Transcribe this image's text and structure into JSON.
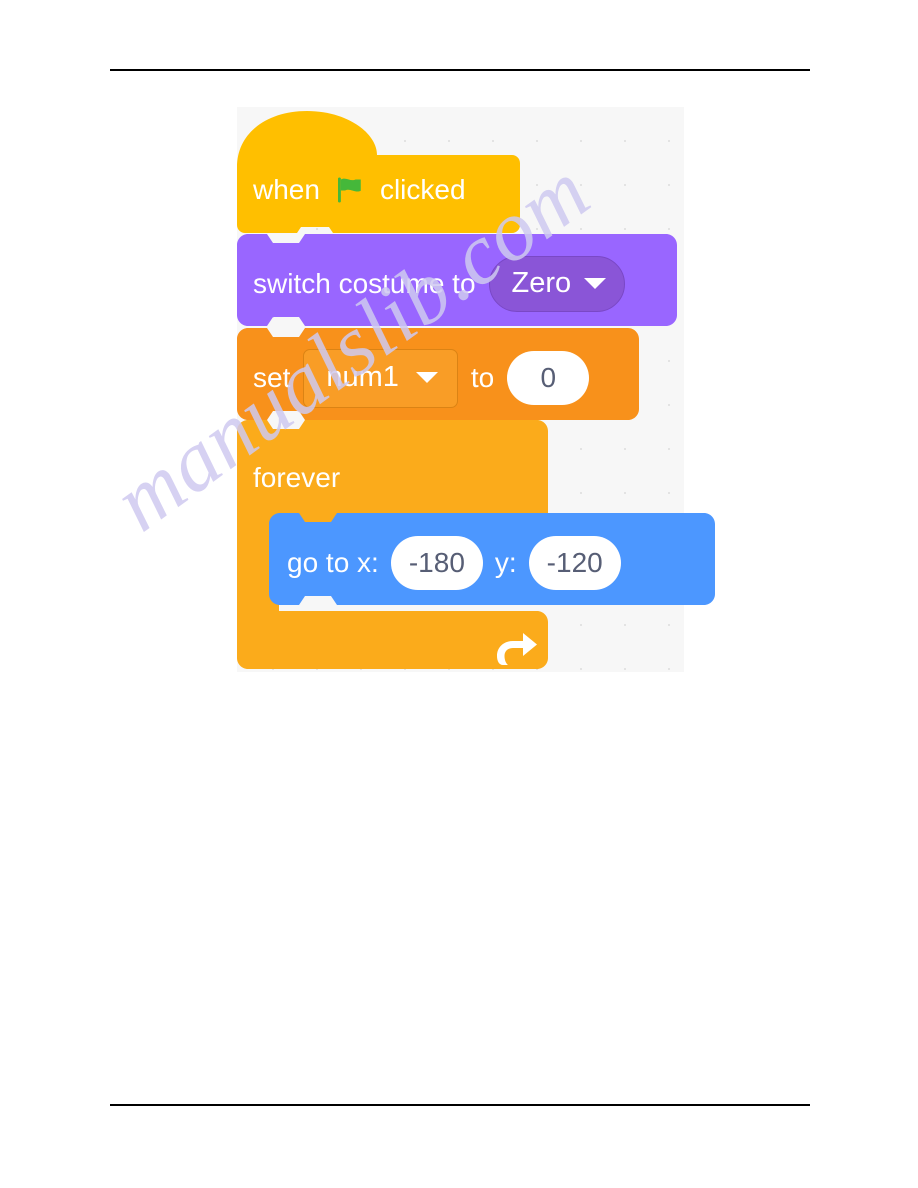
{
  "page": {
    "background_color": "#ffffff",
    "rules": [
      {
        "name": "top-rule"
      },
      {
        "name": "bottom-rule"
      }
    ]
  },
  "watermark": {
    "text": "manualslib.com",
    "color": "#cfcaf0"
  },
  "scratch_script": {
    "canvas_color": "#f7f7f7",
    "blocks": [
      {
        "id": "when-flag-clicked",
        "category": "events",
        "color": "#ffbf00",
        "words": {
          "when": "when",
          "clicked": "clicked"
        },
        "icon": "green-flag-icon",
        "icon_color": "#45b83a"
      },
      {
        "id": "switch-costume-to",
        "category": "looks",
        "color": "#9966ff",
        "field_color": "#8a55d7",
        "label": "switch costume to",
        "dropdown_value": "Zero"
      },
      {
        "id": "set-variable-to",
        "category": "variables",
        "color": "#f8911b",
        "field_color": "#f99d26",
        "label_set": "set",
        "dropdown_value": "num1",
        "label_to": "to",
        "input_value": "0"
      },
      {
        "id": "forever",
        "category": "control",
        "color": "#fbab1b",
        "label": "forever",
        "icon": "loop-arrow-icon"
      },
      {
        "id": "go-to-xy",
        "category": "motion",
        "color": "#4c97ff",
        "label_x": "go to x:",
        "input_x": "-180",
        "label_y": "y:",
        "input_y": "-120"
      }
    ]
  }
}
